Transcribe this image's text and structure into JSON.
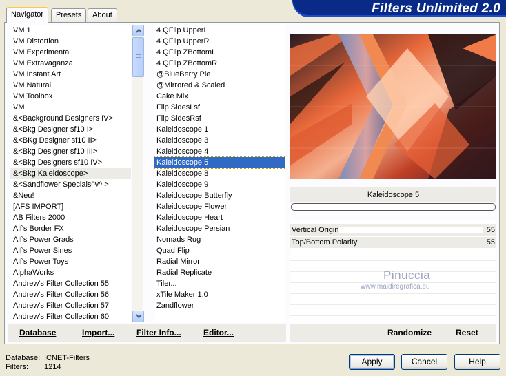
{
  "tabs": [
    "Navigator",
    "Presets",
    "About"
  ],
  "banner_title": "Filters Unlimited 2.0",
  "categories": [
    "VM 1",
    "VM Distortion",
    "VM Experimental",
    "VM Extravaganza",
    "VM Instant Art",
    "VM Natural",
    "VM Toolbox",
    "VM",
    "&<Background Designers IV>",
    "&<Bkg Designer sf10 I>",
    "&<BKg Designer sf10 II>",
    "&<Bkg Designer sf10 III>",
    "&<Bkg Designers sf10 IV>",
    "&<Bkg Kaleidoscope>",
    "&<Sandflower Specials^v^ >",
    "&Neu!",
    "[AFS IMPORT]",
    "AB Filters 2000",
    "Alf's Border FX",
    "Alf's Power Grads",
    "Alf's Power Sines",
    "Alf's Power Toys",
    "AlphaWorks",
    "Andrew's Filter Collection 55",
    "Andrew's Filter Collection 56",
    "Andrew's Filter Collection 57",
    "Andrew's Filter Collection 60"
  ],
  "selected_category": "&<Bkg Kaleidoscope>",
  "filters": [
    "4 QFlip UpperL",
    "4 QFlip UpperR",
    "4 QFlip ZBottomL",
    "4 QFlip ZBottomR",
    "@BlueBerry Pie",
    "@Mirrored & Scaled",
    "Cake Mix",
    "Flip SidesLsf",
    "Flip SidesRsf",
    "Kaleidoscope 1",
    "Kaleidoscope 3",
    "Kaleidoscope 4",
    "Kaleidoscope 5",
    "Kaleidoscope 8",
    "Kaleidoscope 9",
    "Kaleidoscope Butterfly",
    "Kaleidoscope Flower",
    "Kaleidoscope Heart",
    "Kaleidoscope Persian",
    "Nomads Rug",
    "Quad Flip",
    "Radial Mirror",
    "Radial Replicate",
    "Tiler...",
    "xTile Maker 1.0",
    "Zandflower"
  ],
  "selected_filter": "Kaleidoscope 5",
  "preview": {
    "filter_name": "Kaleidoscope 5",
    "params": [
      {
        "name": "Vertical Origin",
        "value": "55"
      },
      {
        "name": "Top/Bottom Polarity",
        "value": "55"
      }
    ],
    "watermark_name": "Pinuccia",
    "watermark_url": "www.maidiregrafica.eu"
  },
  "bar_buttons": {
    "database": "Database",
    "import": "Import...",
    "filter_info": "Filter Info...",
    "editor": "Editor...",
    "randomize": "Randomize",
    "reset": "Reset"
  },
  "footer": {
    "database_label": "Database:",
    "database_value": "ICNET-Filters",
    "filters_label": "Filters:",
    "filters_value": "1214",
    "apply": "Apply",
    "cancel": "Cancel",
    "help": "Help"
  },
  "colors": {
    "selection": "#316ac5",
    "banner": "#0a2a88"
  }
}
